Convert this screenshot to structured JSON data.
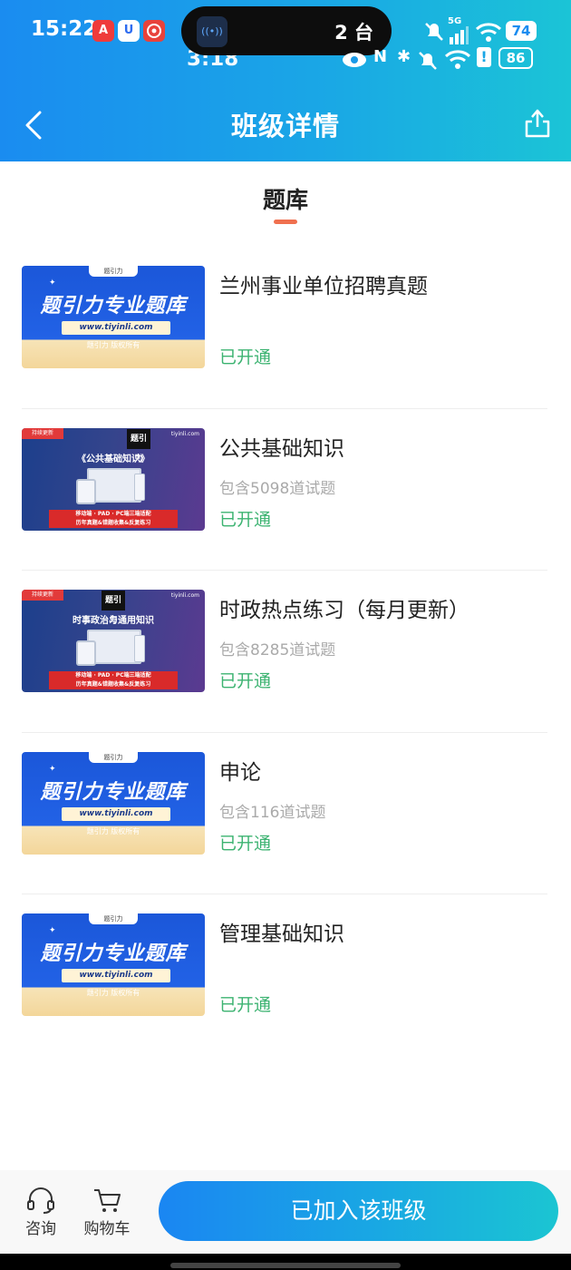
{
  "status_bar": {
    "time": "15:22",
    "app_badges": [
      {
        "icon": "app-a-icon",
        "text": "A",
        "color": "#ef3b3b"
      },
      {
        "icon": "app-u-icon",
        "text": "U",
        "color": "#2d6cf0"
      },
      {
        "icon": "app-seal-icon",
        "text": "",
        "color": "#e8423b"
      }
    ],
    "island_icon_text": "((•))",
    "island_text": "2 台",
    "ghost_time": "3:18",
    "battery_level": "74",
    "ghost_battery_level": "86",
    "network": "5G"
  },
  "nav": {
    "title": "班级详情"
  },
  "section": {
    "title": "题库"
  },
  "thumbnails": {
    "brand_tab": "题引力",
    "brand_title": "题引力专业题库",
    "brand_url": "www.tiyinli.com",
    "brand_copy": "题引力 版权所有",
    "ribbon": "持续更新",
    "site": "tiyinli.com",
    "logo": "题引力",
    "banner_line1": "移动端 · PAD · PC端三端适配",
    "banner_line2": "历年真题&错题收集&反复练习"
  },
  "courses": [
    {
      "name": "兰州事业单位招聘真题",
      "count": "",
      "status": "已开通",
      "thumb": "brand"
    },
    {
      "name": "公共基础知识",
      "count": "包含5098道试题",
      "status": "已开通",
      "thumb": "device",
      "thumb_title": "《公共基础知识》"
    },
    {
      "name": "时政热点练习（每月更新）",
      "count": "包含8285道试题",
      "status": "已开通",
      "thumb": "device",
      "thumb_title": "时事政治与通用知识"
    },
    {
      "name": "申论",
      "count": "包含116道试题",
      "status": "已开通",
      "thumb": "brand"
    },
    {
      "name": "管理基础知识",
      "count": "",
      "status": "已开通",
      "thumb": "brand"
    }
  ],
  "bottom_bar": {
    "consult_label": "咨询",
    "cart_label": "购物车",
    "join_label": "已加入该班级"
  },
  "colors": {
    "header_start": "#1a8cf0",
    "header_end": "#1bc4d6",
    "status_green": "#3cb371",
    "accent_underline": "#f0704f"
  }
}
